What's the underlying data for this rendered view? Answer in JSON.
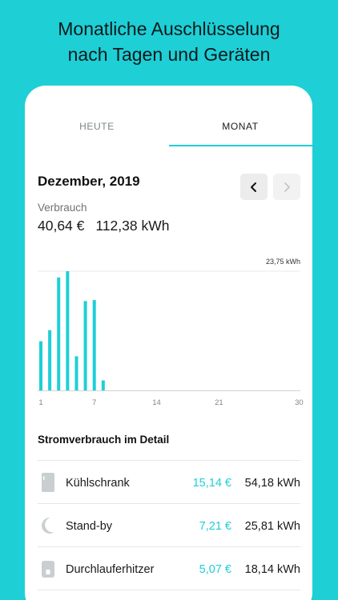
{
  "headline": {
    "line1": "Monatliche Auschlüsselung",
    "line2": "nach Tagen und Geräten"
  },
  "tabs": [
    {
      "label": "HEUTE",
      "active": false
    },
    {
      "label": "MONAT",
      "active": true
    }
  ],
  "period": {
    "title": "Dezember, 2019",
    "prev_icon": "chevron-left-icon",
    "next_icon": "chevron-right-icon"
  },
  "consumption": {
    "label": "Verbrauch",
    "cost": "40,64 €",
    "energy": "112,38 kWh"
  },
  "colors": {
    "accent": "#1ecfd6",
    "background": "#1ecfd6"
  },
  "chart_data": {
    "type": "bar",
    "max_label": "23,75 kWh",
    "x_ticks": [
      "1",
      "7",
      "14",
      "21",
      "30"
    ],
    "tick_days": [
      1,
      7,
      14,
      21,
      30
    ],
    "days": [
      1,
      2,
      3,
      4,
      5,
      6,
      7,
      8,
      9,
      10,
      11,
      12,
      13,
      14,
      15,
      16,
      17,
      18,
      19,
      20,
      21,
      22,
      23,
      24,
      25,
      26,
      27,
      28,
      29,
      30
    ],
    "values": [
      9.8,
      12.0,
      22.5,
      23.75,
      6.8,
      17.8,
      18.0,
      2.0,
      0,
      0,
      0,
      0,
      0,
      0,
      0,
      0,
      0,
      0,
      0,
      0,
      0,
      0,
      0,
      0,
      0,
      0,
      0,
      0,
      0,
      0
    ],
    "ylim": [
      0,
      23.75
    ],
    "grid": true
  },
  "detail": {
    "title": "Stromverbrauch im Detail",
    "devices": [
      {
        "icon": "fridge-icon",
        "name": "Kühlschrank",
        "cost": "15,14 €",
        "energy": "54,18 kWh"
      },
      {
        "icon": "moon-icon",
        "name": "Stand-by",
        "cost": "7,21 €",
        "energy": "25,81 kWh"
      },
      {
        "icon": "water-heater-icon",
        "name": "Durchlauferhitzer",
        "cost": "5,07 €",
        "energy": "18,14 kWh"
      }
    ]
  }
}
